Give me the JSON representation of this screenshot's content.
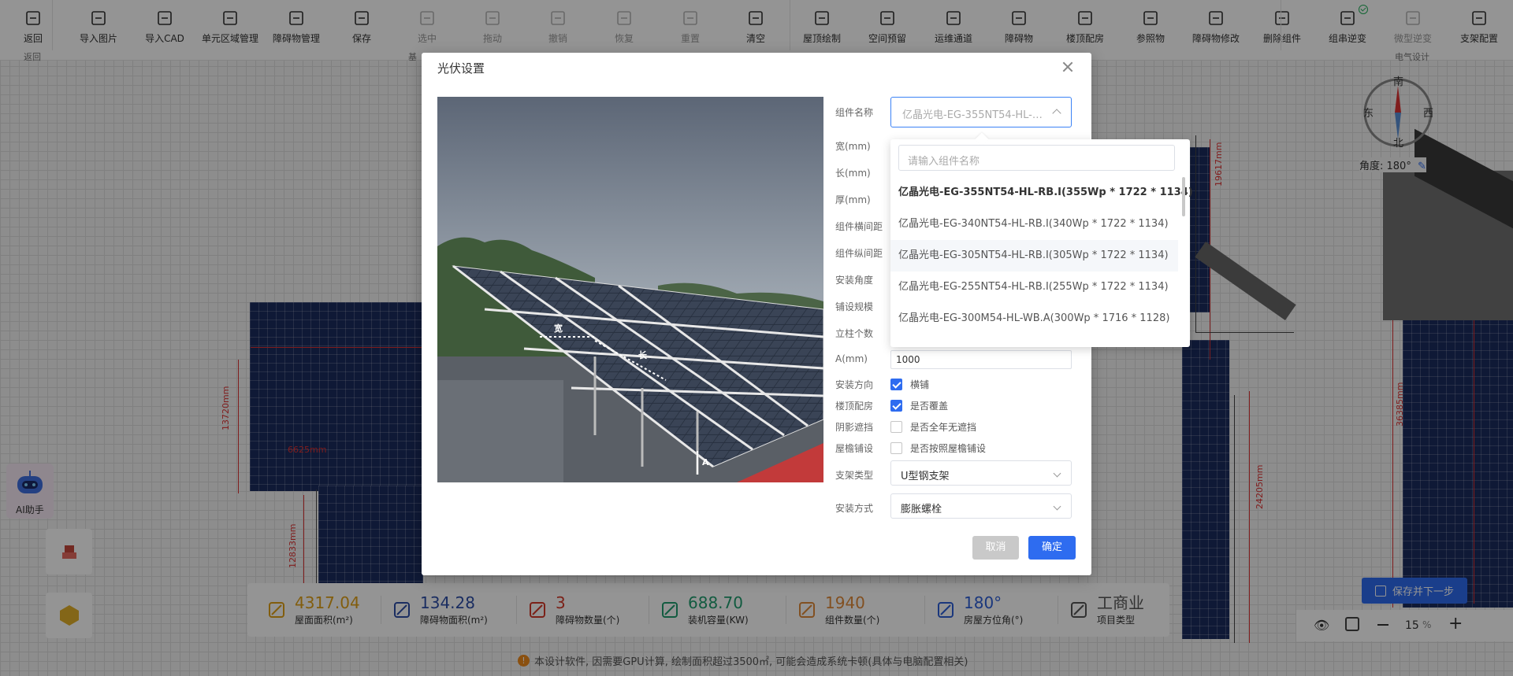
{
  "toolbar": {
    "items": [
      {
        "label": "返回",
        "icon": "back-icon"
      },
      {
        "label": "导入图片",
        "icon": "image-import-icon"
      },
      {
        "label": "导入CAD",
        "icon": "cad-import-icon"
      },
      {
        "label": "单元区域管理",
        "icon": "region-manage-icon"
      },
      {
        "label": "障碍物管理",
        "icon": "obstacle-manage-icon"
      },
      {
        "label": "保存",
        "icon": "save-icon"
      },
      {
        "label": "选中",
        "icon": "select-icon"
      },
      {
        "label": "拖动",
        "icon": "drag-icon"
      },
      {
        "label": "撤销",
        "icon": "undo-icon"
      },
      {
        "label": "恢复",
        "icon": "redo-icon"
      },
      {
        "label": "重置",
        "icon": "reset-icon"
      },
      {
        "label": "清空",
        "icon": "trash-icon"
      },
      {
        "label": "屋顶绘制",
        "icon": "roof-draw-icon"
      },
      {
        "label": "空间预留",
        "icon": "space-reserve-icon"
      },
      {
        "label": "运维通道",
        "icon": "maintenance-channel-icon"
      },
      {
        "label": "障碍物",
        "icon": "obstacle-icon"
      },
      {
        "label": "楼顶配房",
        "icon": "rooftop-room-icon"
      },
      {
        "label": "参照物",
        "icon": "reference-icon"
      },
      {
        "label": "障碍物修改",
        "icon": "obstacle-edit-icon"
      },
      {
        "label": "删除组件",
        "icon": "delete-component-icon"
      },
      {
        "label": "组串逆变",
        "icon": "string-inverter-icon"
      },
      {
        "label": "微型逆变",
        "icon": "micro-inverter-icon"
      },
      {
        "label": "支架配置",
        "icon": "bracket-config-icon"
      }
    ],
    "group_labels": {
      "back": "返回",
      "basic": "基",
      "electrical": "电气设计"
    }
  },
  "dialog": {
    "title": "光伏设置",
    "component_name_label": "组件名称",
    "component_name_value": "亿晶光电-EG-355NT54-HL-RB.I(355Wp * 1722 * 1134)",
    "dropdown": {
      "search_placeholder": "请输入组件名称",
      "options": [
        "亿晶光电-EG-355NT54-HL-RB.I(355Wp * 1722 * 1134)",
        "亿晶光电-EG-340NT54-HL-RB.I(340Wp * 1722 * 1134)",
        "亿晶光电-EG-305NT54-HL-RB.I(305Wp * 1722 * 1134)",
        "亿晶光电-EG-255NT54-HL-RB.I(255Wp * 1722 * 1134)",
        "亿晶光电-EG-300M54-HL-WB.A(300Wp * 1716 * 1128)"
      ]
    },
    "labels": {
      "width": "宽(mm)",
      "length": "长(mm)",
      "thickness": "厚(mm)",
      "h_spacing": "组件横间距",
      "v_spacing": "组件纵间距",
      "angle": "安装角度",
      "scale": "铺设规模",
      "posts": "立柱个数",
      "a": "A(mm)",
      "direction": "安装方向",
      "rooftop_room": "楼顶配房",
      "shadow": "阴影遮挡",
      "eaves": "屋檐铺设",
      "bracket_type": "支架类型",
      "install_method": "安装方式"
    },
    "a_value": "1000",
    "checkboxes": {
      "direction": {
        "label": "横铺",
        "checked": true
      },
      "rooftop_room": {
        "label": "是否覆盖",
        "checked": true
      },
      "shadow": {
        "label": "是否全年无遮挡",
        "checked": false
      },
      "eaves": {
        "label": "是否按照屋檐铺设",
        "checked": false
      }
    },
    "bracket_type_value": "U型钢支架",
    "install_method_value": "膨胀螺栓",
    "photo_labels": {
      "width_mark": "宽",
      "length_mark": "长",
      "a_mark": "A"
    },
    "cancel": "取消",
    "ok": "确定"
  },
  "stats": [
    {
      "value": "4317.04",
      "label": "屋面面积(m²)",
      "color": "#e0a018",
      "icon": "roof-area-icon"
    },
    {
      "value": "134.28",
      "label": "障碍物面积(m²)",
      "color": "#2e4ea8",
      "icon": "obstacle-area-icon"
    },
    {
      "value": "3",
      "label": "障碍物数量(个)",
      "color": "#d43a2a",
      "icon": "cone-icon"
    },
    {
      "value": "688.70",
      "label": "装机容量(KW)",
      "color": "#1f9d6e",
      "icon": "capacity-icon"
    },
    {
      "value": "1940",
      "label": "组件数量(个)",
      "color": "#e08a3a",
      "icon": "panel-count-icon"
    },
    {
      "value": "180°",
      "label": "房屋方位角(°)",
      "color": "#2e5fd8",
      "icon": "azimuth-icon"
    },
    {
      "value": "工商业",
      "label": "项目类型",
      "color": "#555555",
      "icon": "project-type-icon"
    }
  ],
  "notice": "本设计软件, 因需要GPU计算, 绘制面积超过3500㎡, 可能会造成系统卡顿(具体与电脑配置相关)",
  "save_next": "保存并下一步",
  "zoom": {
    "value": "15",
    "unit": "%"
  },
  "ai_label": "AI助手",
  "compass": {
    "south": "南",
    "north": "北",
    "east": "东",
    "west": "西",
    "angle_label": "角度: 180°"
  },
  "dimensions": [
    "19617mm",
    "13720mm",
    "6625mm",
    "12833mm",
    "24205mm",
    "36385mm"
  ]
}
